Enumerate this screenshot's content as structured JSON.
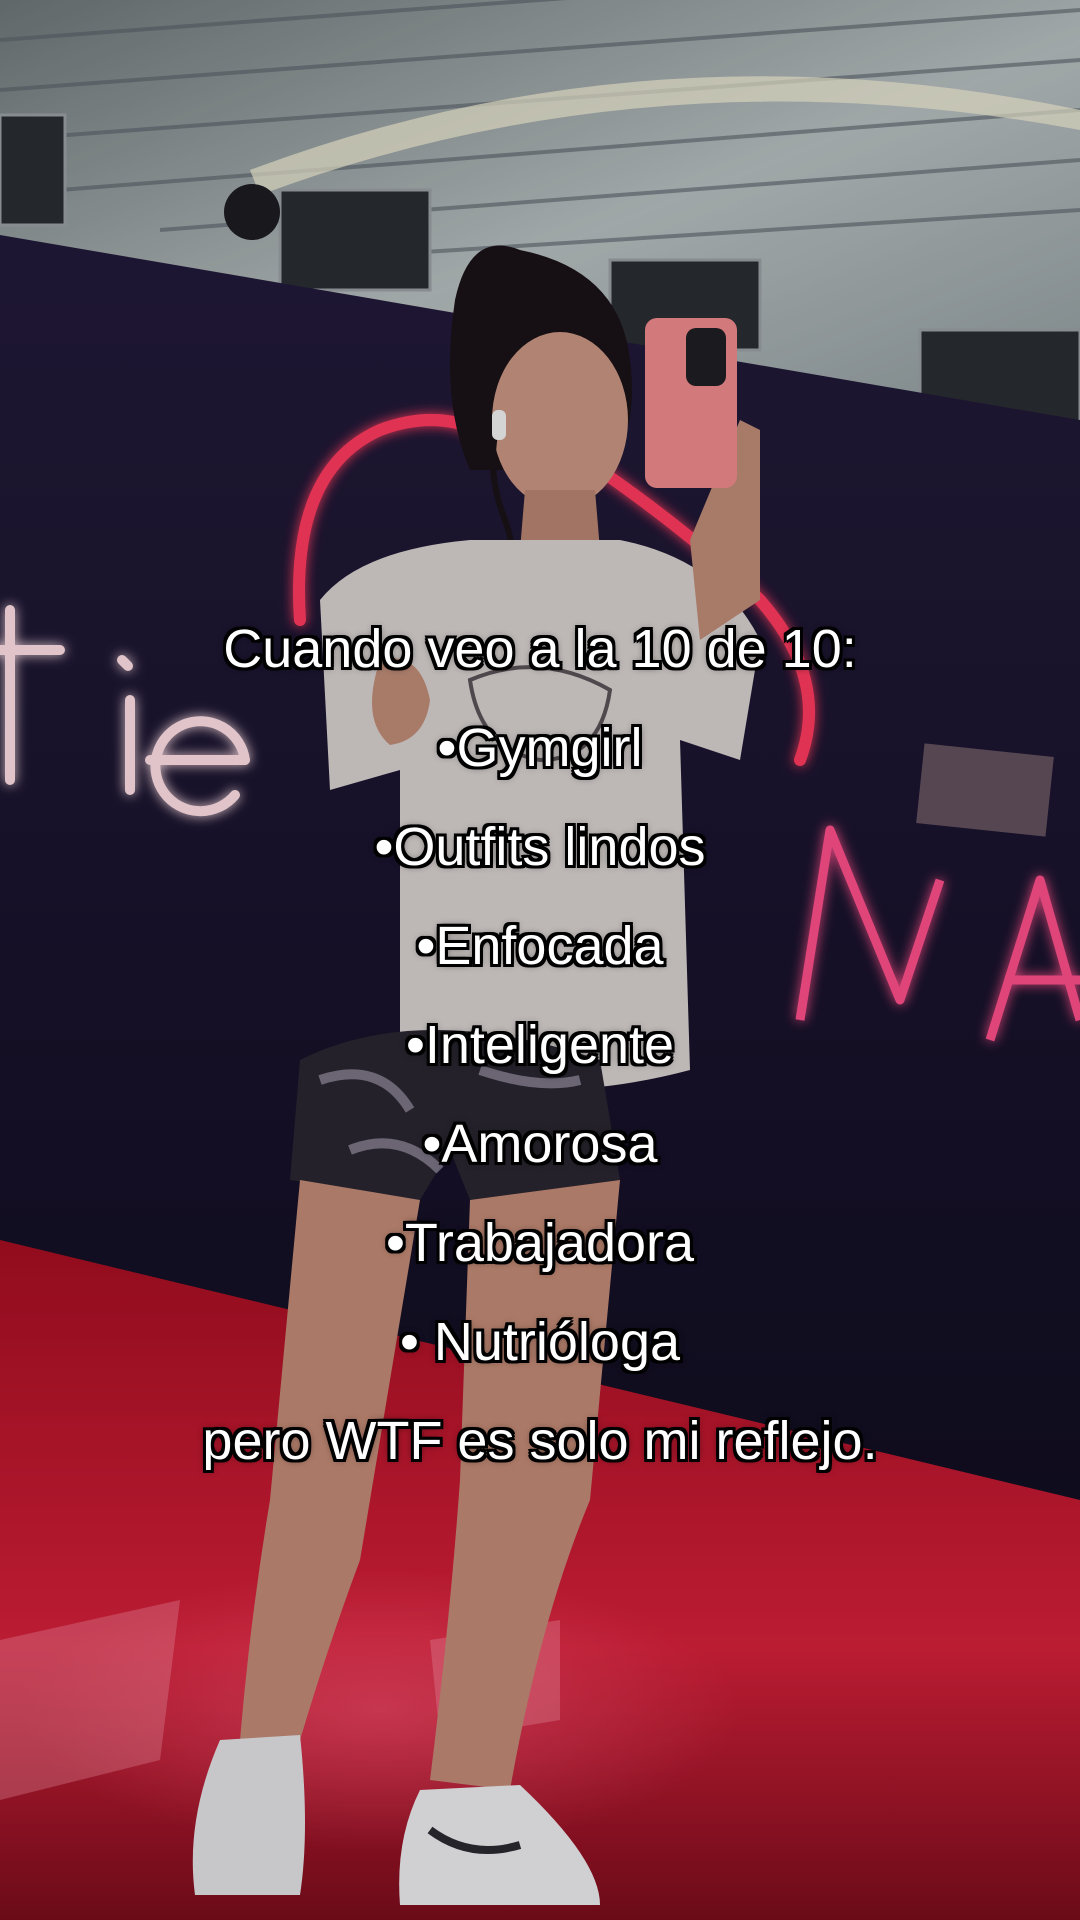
{
  "colors": {
    "neon_red": "#ff2d55",
    "neon_pink": "#ff4f8b",
    "floor_red": "#c4102a",
    "wall_navy": "#1b1530",
    "ceiling": "#9aa4a8",
    "caption_text": "#ffffff",
    "caption_outline": "#000000"
  },
  "caption": {
    "line1": "Cuando veo a la 10 de 10:",
    "line2": "•Gymgirl",
    "line3": "•Outfits lindos",
    "line4": "•Enfocada",
    "line5": "•Inteligente",
    "line6": "•Amorosa",
    "line7": "•Trabajadora",
    "line8": "• Nutrióloga",
    "line9": "pero WTF es solo mi reflejo."
  }
}
